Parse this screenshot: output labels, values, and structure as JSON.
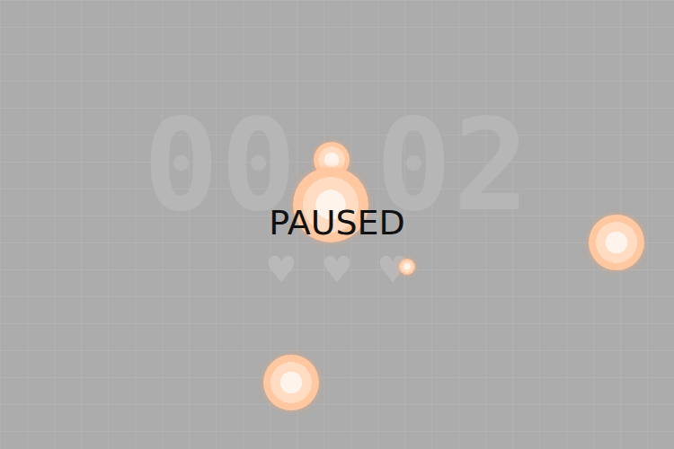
{
  "timer": "00.02",
  "lives": [
    {
      "icon": "♥",
      "filled": true
    },
    {
      "icon": "♥",
      "filled": true
    },
    {
      "icon": "♥",
      "filled": true
    }
  ],
  "orbs": [
    {
      "kind": "small"
    },
    {
      "kind": "large"
    },
    {
      "kind": "tiny"
    },
    {
      "kind": "medium"
    },
    {
      "kind": "medium"
    }
  ],
  "overlay": {
    "text": "PAUSED",
    "paused": true
  }
}
